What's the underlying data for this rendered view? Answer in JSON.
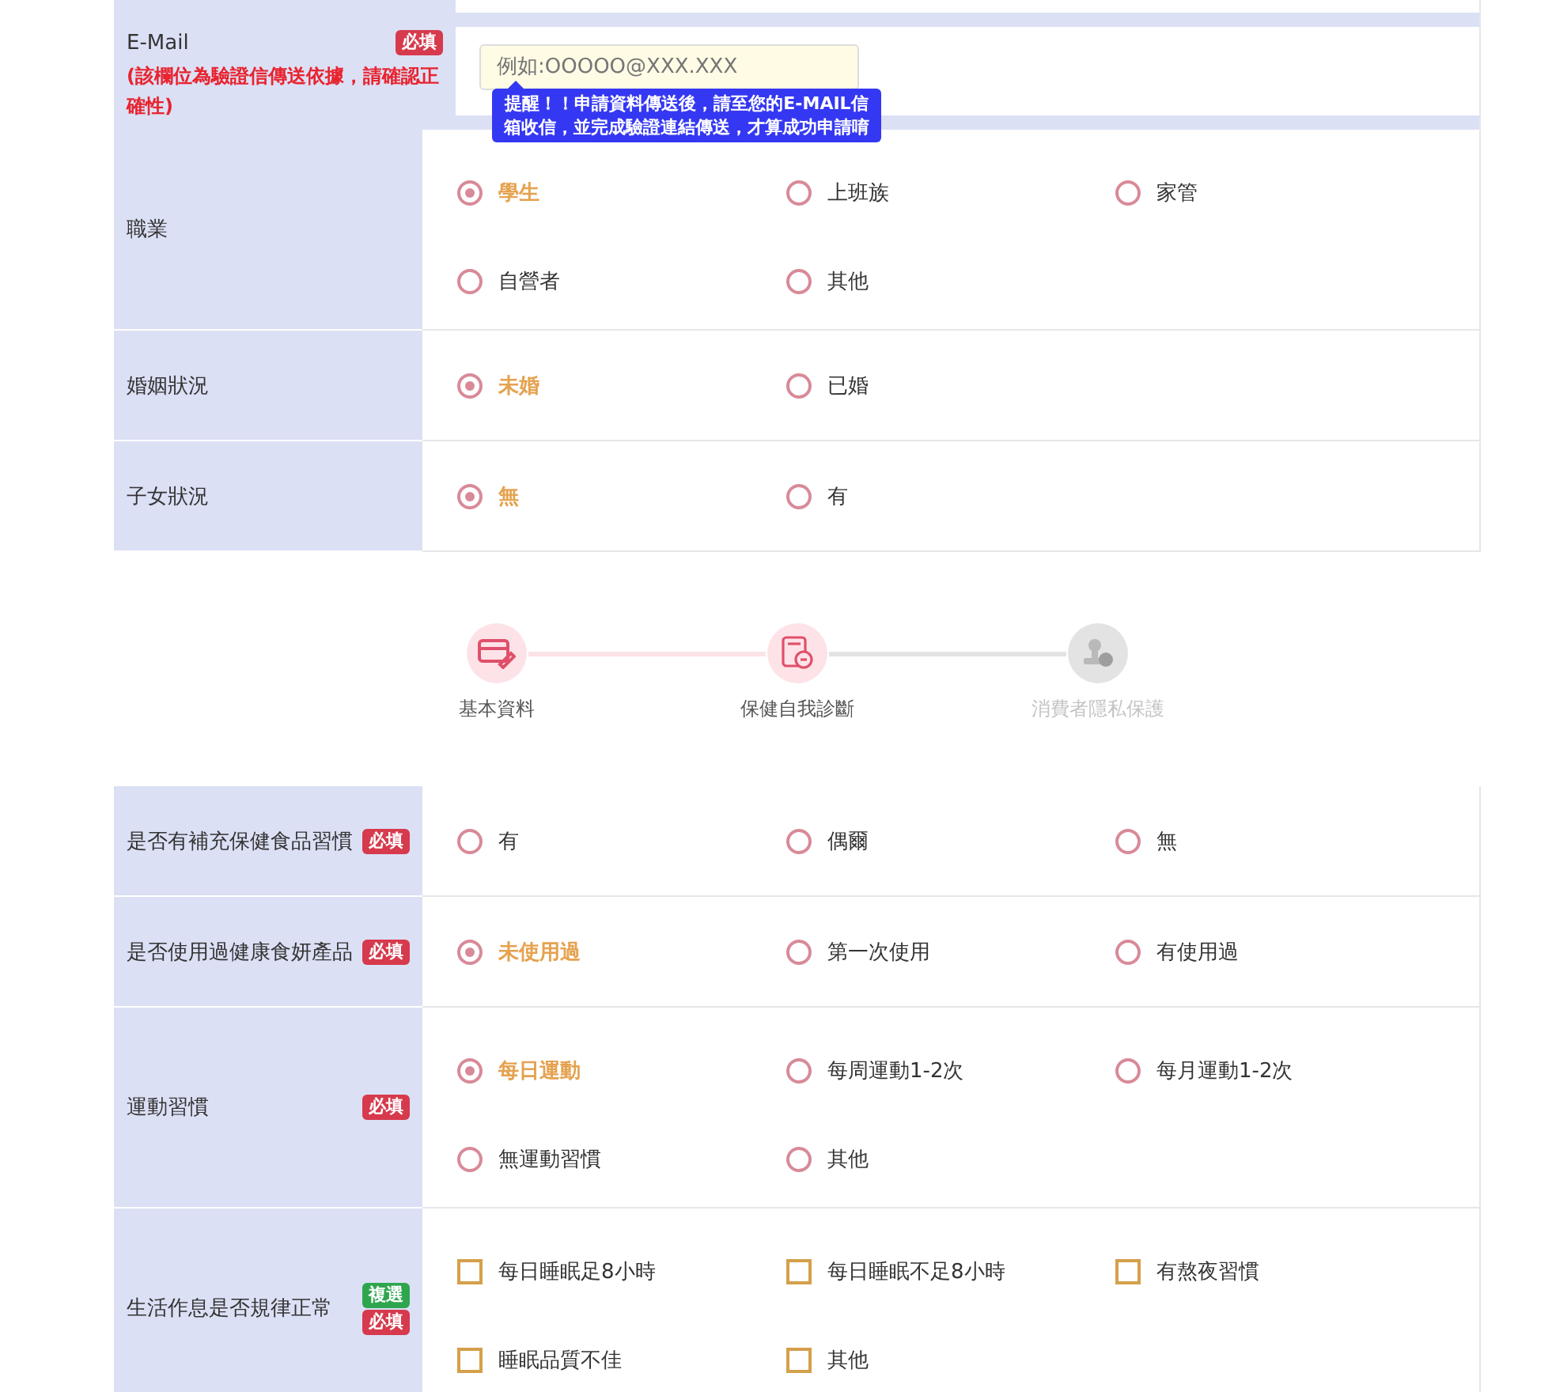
{
  "basic_form": {
    "rows": [
      {
        "kind": "email",
        "label": "E-Mail",
        "badges": [
          {
            "text": "必填",
            "kind": "required"
          }
        ],
        "note": "(該欄位為驗證信傳送依據，請確認正確性)",
        "field": {
          "placeholder": "例如:OOOOO@XXX.XXX"
        },
        "tooltip": "提醒！！申請資料傳送後，請至您的E-MAIL信箱收信，並完成驗證連結傳送，才算成功申請唷"
      },
      {
        "kind": "radio",
        "label": "職業",
        "badges": [],
        "options": [
          {
            "label": "學生",
            "selected": true
          },
          {
            "label": "上班族",
            "selected": false
          },
          {
            "label": "家管",
            "selected": false
          },
          {
            "label": "自營者",
            "selected": false
          },
          {
            "label": "其他",
            "selected": false
          }
        ]
      },
      {
        "kind": "radio",
        "label": "婚姻狀況",
        "badges": [],
        "options": [
          {
            "label": "未婚",
            "selected": true
          },
          {
            "label": "已婚",
            "selected": false
          }
        ]
      },
      {
        "kind": "radio",
        "label": "子女狀況",
        "badges": [],
        "options": [
          {
            "label": "無",
            "selected": true
          },
          {
            "label": "有",
            "selected": false
          }
        ]
      }
    ]
  },
  "stepper": {
    "steps": [
      {
        "label": "基本資料",
        "kind": "done"
      },
      {
        "label": "保健自我診斷",
        "kind": "active"
      },
      {
        "label": "消費者隱私保護",
        "kind": "pending"
      }
    ]
  },
  "health_form": {
    "rows": [
      {
        "kind": "radio",
        "label": "是否有補充保健食品習慣",
        "badges": [
          {
            "text": "必填",
            "kind": "required"
          }
        ],
        "options": [
          {
            "label": "有",
            "selected": false
          },
          {
            "label": "偶爾",
            "selected": false
          },
          {
            "label": "無",
            "selected": false
          }
        ]
      },
      {
        "kind": "radio",
        "label": "是否使用過健康食妍產品",
        "badges": [
          {
            "text": "必填",
            "kind": "required"
          }
        ],
        "options": [
          {
            "label": "未使用過",
            "selected": true
          },
          {
            "label": "第一次使用",
            "selected": false
          },
          {
            "label": "有使用過",
            "selected": false
          }
        ]
      },
      {
        "kind": "radio",
        "label": "運動習慣",
        "badges": [
          {
            "text": "必填",
            "kind": "required"
          }
        ],
        "options": [
          {
            "label": "每日運動",
            "selected": true
          },
          {
            "label": "每周運動1-2次",
            "selected": false
          },
          {
            "label": "每月運動1-2次",
            "selected": false
          },
          {
            "label": "無運動習慣",
            "selected": false
          },
          {
            "label": "其他",
            "selected": false
          }
        ]
      },
      {
        "kind": "checkbox",
        "label": "生活作息是否規律正常",
        "badges": [
          {
            "text": "複選",
            "kind": "multi"
          },
          {
            "text": "必填",
            "kind": "required"
          }
        ],
        "options": [
          {
            "label": "每日睡眠足8小時",
            "checked": false
          },
          {
            "label": "每日睡眠不足8小時",
            "checked": false
          },
          {
            "label": "有熬夜習慣",
            "checked": false
          },
          {
            "label": "睡眠品質不佳",
            "checked": false
          },
          {
            "label": "其他",
            "checked": false
          }
        ]
      }
    ]
  }
}
